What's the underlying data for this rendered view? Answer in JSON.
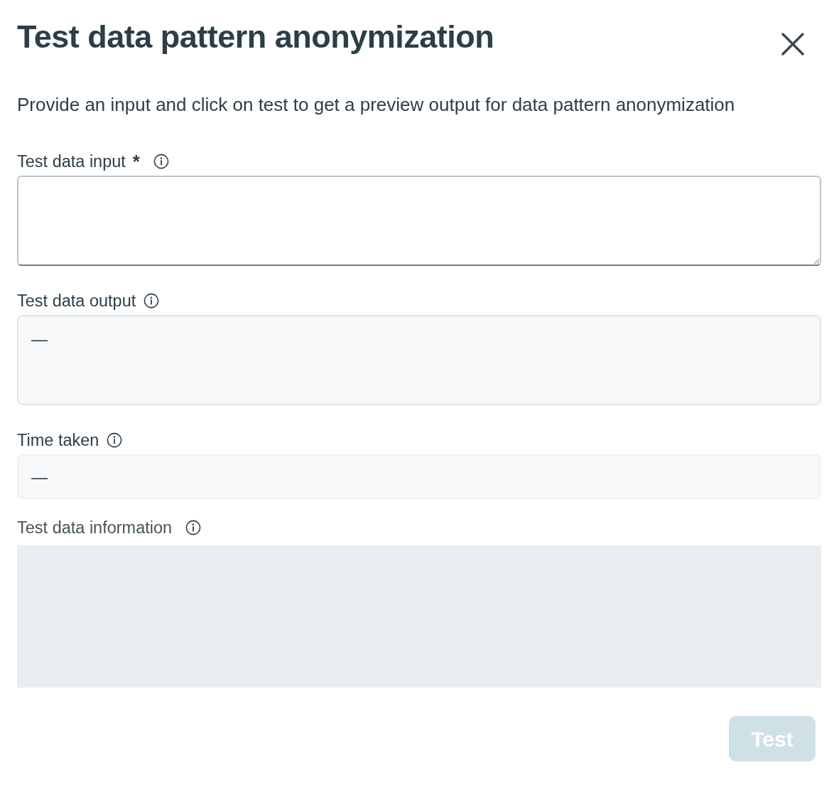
{
  "dialog": {
    "title": "Test data pattern anonymization",
    "description": "Provide an input and click on test to get a preview output for data pattern anonymization"
  },
  "fields": [
    {
      "kind": "textarea",
      "label": "Test data input",
      "required_mark": "*"
    },
    {
      "kind": "multiline_output",
      "label": "Test data output",
      "value": "—"
    },
    {
      "kind": "single_output",
      "label": "Time taken",
      "value": "—"
    },
    {
      "kind": "panel",
      "label": "Test data information"
    }
  ],
  "button": {
    "label": "Test",
    "disabled": true
  }
}
